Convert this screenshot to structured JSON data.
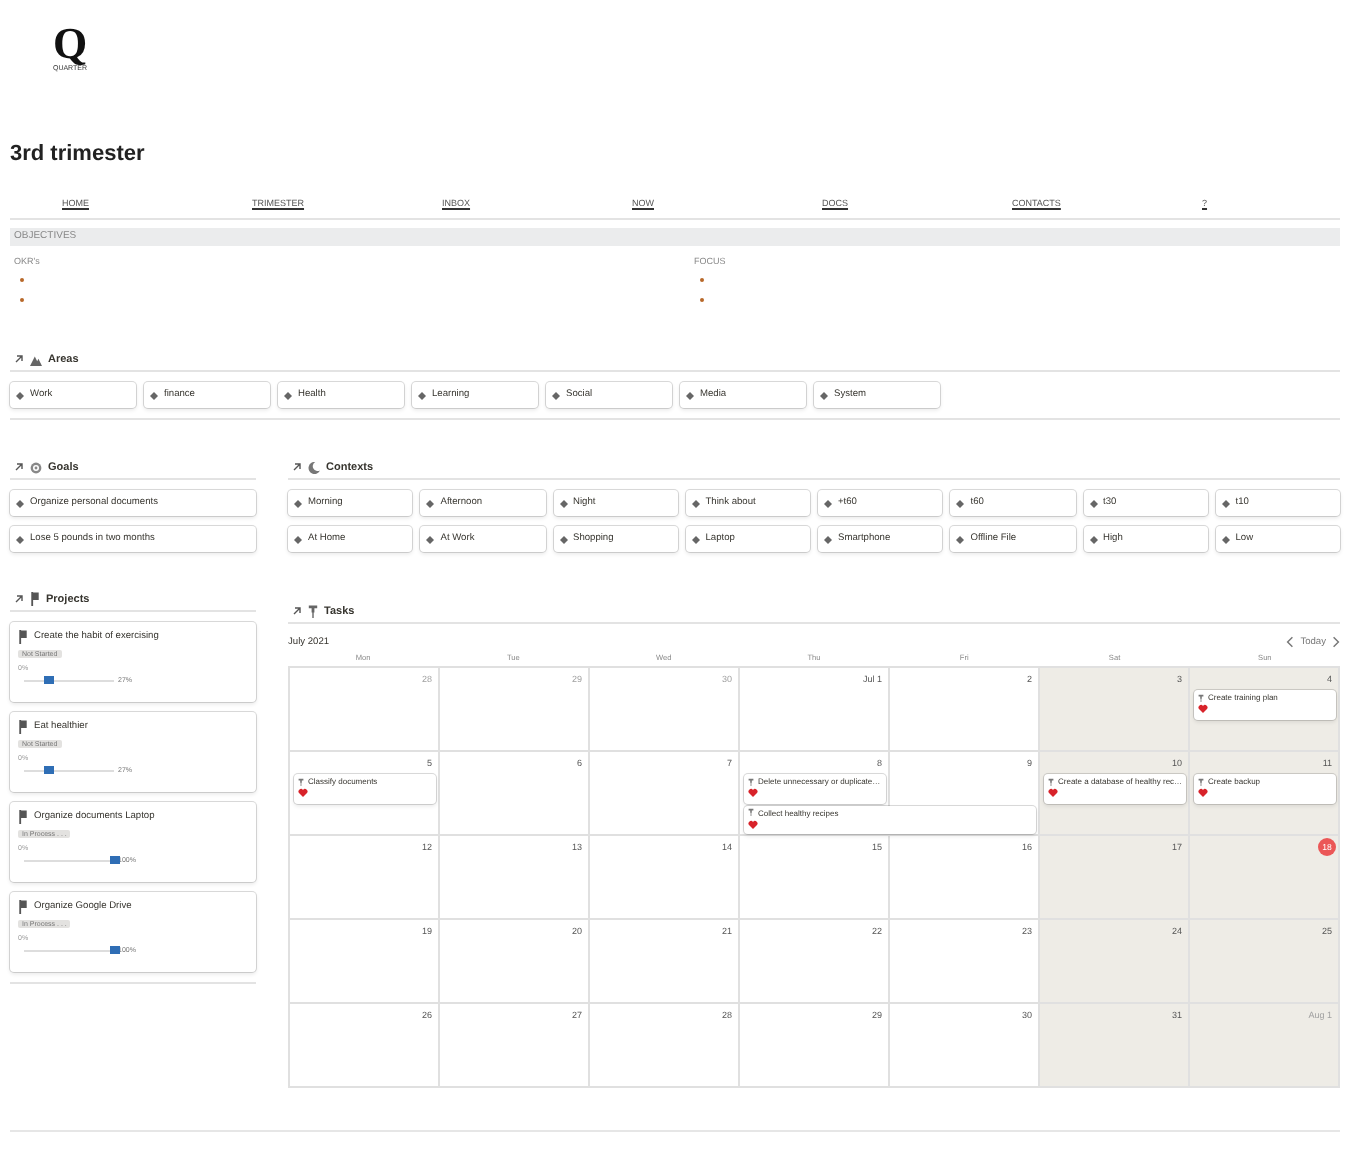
{
  "logo": {
    "letter": "Q",
    "name": "QUARTER"
  },
  "title": "3rd trimester",
  "nav": [
    "HOME",
    "TRIMESTER",
    "INBOX",
    "NOW",
    "DOCS",
    "CONTACTS",
    "?"
  ],
  "objectives": {
    "heading": "OBJECTIVES",
    "columns": [
      {
        "label": "OKR's",
        "bullets": [
          {
            "kind": "empty"
          },
          {
            "kind": "empty"
          }
        ]
      },
      {
        "label": "FOCUS",
        "bullets": [
          {
            "kind": "empty"
          },
          {
            "kind": "empty"
          }
        ]
      }
    ]
  },
  "areas": {
    "title": "Areas",
    "items": [
      "Work",
      "finance",
      "Health",
      "Learning",
      "Social",
      "Media",
      "System"
    ]
  },
  "goals": {
    "title": "Goals",
    "items": [
      "Organize personal documents",
      "Lose 5 pounds in two months"
    ]
  },
  "contexts": {
    "title": "Contexts",
    "items": [
      "Morning",
      "Afternoon",
      "Night",
      "Think about",
      "+t60",
      "t60",
      "t30",
      "t10",
      "At Home",
      "At Work",
      "Shopping",
      "Laptop",
      "Smartphone",
      "Offline File",
      "High",
      "Low"
    ]
  },
  "projects": {
    "title": "Projects",
    "items": [
      {
        "name": "Create the habit of exercising",
        "status": "Not Started",
        "percent": "0%",
        "level": 0.27,
        "reading": "27%"
      },
      {
        "name": "Eat healthier",
        "status": "Not Started",
        "percent": "0%",
        "level": 0.27,
        "reading": "27%"
      },
      {
        "name": "Organize documents Laptop",
        "status": "In Process . . .",
        "percent": "0%",
        "level": 1,
        "reading": "100%"
      },
      {
        "name": "Organize Google Drive",
        "status": "In Process . . .",
        "percent": "0%",
        "level": 1,
        "reading": "100%"
      }
    ]
  },
  "tasks": {
    "title": "Tasks",
    "month": "July 2021",
    "today_button": "Today",
    "weekdays": [
      {
        "label": "Mon",
        "weekend": false
      },
      {
        "label": "Tue",
        "weekend": false
      },
      {
        "label": "Wed",
        "weekend": false
      },
      {
        "label": "Thu",
        "weekend": false
      },
      {
        "label": "Fri",
        "weekend": false
      },
      {
        "label": "Sat",
        "weekend": true
      },
      {
        "label": "Sun",
        "weekend": true
      }
    ],
    "weeks": [
      {
        "days": [
          {
            "label": "28",
            "muted": true,
            "today": false
          },
          {
            "label": "29",
            "muted": true,
            "today": false
          },
          {
            "label": "30",
            "muted": true,
            "today": false
          },
          {
            "label": "Jul 1",
            "muted": false,
            "today": false
          },
          {
            "label": "2",
            "muted": false,
            "today": false
          },
          {
            "label": "3",
            "muted": false,
            "today": false
          },
          {
            "label": "4",
            "muted": false,
            "today": false,
            "events": [
              {
                "title": "Create training plan",
                "kind": "single"
              }
            ]
          }
        ]
      },
      {
        "days": [
          {
            "label": "5",
            "muted": false,
            "today": false,
            "events": [
              {
                "title": "Classify documents",
                "kind": "single"
              }
            ]
          },
          {
            "label": "6",
            "muted": false,
            "today": false
          },
          {
            "label": "7",
            "muted": false,
            "today": false
          },
          {
            "label": "8",
            "muted": false,
            "today": false,
            "events": [
              {
                "title": "Delete unnecessary or duplicate…",
                "kind": "single"
              },
              {
                "title": "Collect healthy recipes",
                "kind": "two-day"
              }
            ]
          },
          {
            "label": "9",
            "muted": false,
            "today": false
          },
          {
            "label": "10",
            "muted": false,
            "today": false,
            "events": [
              {
                "title": "Create a database of healthy rec…",
                "kind": "single"
              }
            ]
          },
          {
            "label": "11",
            "muted": false,
            "today": false,
            "events": [
              {
                "title": "Create backup",
                "kind": "single"
              }
            ]
          }
        ]
      },
      {
        "days": [
          {
            "label": "12",
            "muted": false,
            "today": false
          },
          {
            "label": "13",
            "muted": false,
            "today": false
          },
          {
            "label": "14",
            "muted": false,
            "today": false
          },
          {
            "label": "15",
            "muted": false,
            "today": false
          },
          {
            "label": "16",
            "muted": false,
            "today": false
          },
          {
            "label": "17",
            "muted": false,
            "today": false
          },
          {
            "label": "18",
            "muted": false,
            "today": true
          }
        ]
      },
      {
        "days": [
          {
            "label": "19",
            "muted": false,
            "today": false
          },
          {
            "label": "20",
            "muted": false,
            "today": false
          },
          {
            "label": "21",
            "muted": false,
            "today": false
          },
          {
            "label": "22",
            "muted": false,
            "today": false
          },
          {
            "label": "23",
            "muted": false,
            "today": false
          },
          {
            "label": "24",
            "muted": false,
            "today": false
          },
          {
            "label": "25",
            "muted": false,
            "today": false
          }
        ]
      },
      {
        "days": [
          {
            "label": "26",
            "muted": false,
            "today": false
          },
          {
            "label": "27",
            "muted": false,
            "today": false
          },
          {
            "label": "28",
            "muted": false,
            "today": false
          },
          {
            "label": "29",
            "muted": false,
            "today": false
          },
          {
            "label": "30",
            "muted": false,
            "today": false
          },
          {
            "label": "31",
            "muted": false,
            "today": false
          },
          {
            "label": "Aug 1",
            "muted": true,
            "today": false
          }
        ]
      }
    ]
  }
}
